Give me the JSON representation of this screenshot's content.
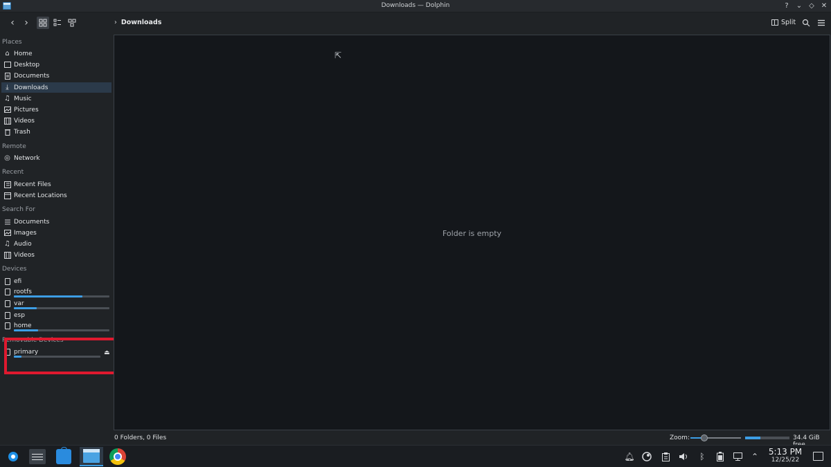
{
  "window": {
    "title": "Downloads — Dolphin",
    "controls": [
      "?",
      "⌄",
      "◇",
      "✕"
    ]
  },
  "toolbar": {
    "back": "‹",
    "forward": "›",
    "breadcrumb_chevron": "›",
    "breadcrumb": "Downloads",
    "split_label": "Split"
  },
  "sidebar": {
    "places_title": "Places",
    "places": [
      "Home",
      "Desktop",
      "Documents",
      "Downloads",
      "Music",
      "Pictures",
      "Videos",
      "Trash"
    ],
    "remote_title": "Remote",
    "remote": [
      "Network"
    ],
    "recent_title": "Recent",
    "recent": [
      "Recent Files",
      "Recent Locations"
    ],
    "search_title": "Search For",
    "search": [
      "Documents",
      "Images",
      "Audio",
      "Videos"
    ],
    "devices_title": "Devices",
    "devices": [
      {
        "label": "efi",
        "usage": null
      },
      {
        "label": "rootfs",
        "usage": 0.72
      },
      {
        "label": "var",
        "usage": 0.24
      },
      {
        "label": "esp",
        "usage": null
      },
      {
        "label": "home",
        "usage": 0.25
      }
    ],
    "removable_title": "Removable Devices",
    "removable": [
      {
        "label": "primary",
        "usage": 0.09
      }
    ]
  },
  "main": {
    "empty_text": "Folder is empty"
  },
  "status": {
    "counts": "0 Folders, 0 Files",
    "zoom_label": "Zoom:",
    "zoom_level": 0.28,
    "space_used": 0.35,
    "free": "34.4 GiB free"
  },
  "taskbar": {
    "time": "5:13 PM",
    "date": "12/25/22"
  },
  "colors": {
    "accent": "#3d9ee5",
    "highlight_box": "#e0192f"
  }
}
